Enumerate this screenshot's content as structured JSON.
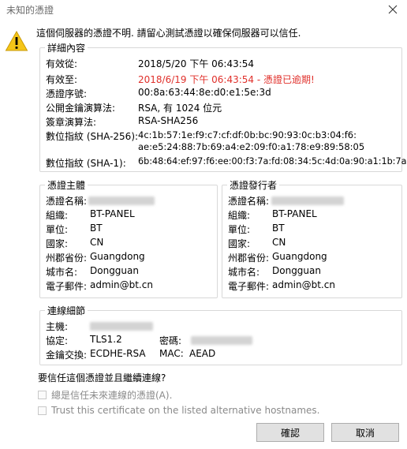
{
  "window": {
    "title": "未知的憑證"
  },
  "header": {
    "message": "這個伺服器的憑證不明. 請留心測試憑證以確保伺服器可以信任."
  },
  "details": {
    "legend": "詳細內容",
    "rows": [
      {
        "label": "有效從:",
        "value": "2018/5/20 下午 06:43:54"
      },
      {
        "label": "有效至:",
        "value": "2018/6/19 下午 06:43:54 - 憑證已逾期!"
      },
      {
        "label": "憑證序號:",
        "value": "00:8a:63:44:8e:d0:e1:5e:3d"
      },
      {
        "label": "公開金鑰演算法:",
        "value": "RSA, 有 1024 位元"
      },
      {
        "label": "簽章演算法:",
        "value": "RSA-SHA256"
      },
      {
        "label": "數位指紋 (SHA-256):",
        "value": "4c:1b:57:1e:f9:c7:cf:df:0b:bc:90:93:0c:b3:04:f6:",
        "value2": "ae:e5:24:88:7b:69:a4:e2:09:f0:a1:78:e9:89:58:05"
      },
      {
        "label": "數位指紋 (SHA-1):",
        "value": "6b:48:64:ef:97:f6:ee:00:f3:7a:fd:08:34:5c:4d:0a:90:a1:1b:7a"
      }
    ],
    "expired_color": "#e0302b"
  },
  "subject": {
    "legend": "憑證主體",
    "rows": [
      {
        "label": "憑證名稱:",
        "value": ""
      },
      {
        "label": "組織:",
        "value": "BT-PANEL"
      },
      {
        "label": "單位:",
        "value": "BT"
      },
      {
        "label": "國家:",
        "value": "CN"
      },
      {
        "label": "州郡省份:",
        "value": "Guangdong"
      },
      {
        "label": "城市名:",
        "value": "Dongguan"
      },
      {
        "label": "電子郵件:",
        "value": "admin@bt.cn"
      }
    ]
  },
  "issuer": {
    "legend": "憑證發行者",
    "rows": [
      {
        "label": "憑證名稱:",
        "value": ""
      },
      {
        "label": "組織:",
        "value": "BT-PANEL"
      },
      {
        "label": "單位:",
        "value": "BT"
      },
      {
        "label": "國家:",
        "value": "CN"
      },
      {
        "label": "州郡省份:",
        "value": "Guangdong"
      },
      {
        "label": "城市名:",
        "value": "Dongguan"
      },
      {
        "label": "電子郵件:",
        "value": "admin@bt.cn"
      }
    ]
  },
  "connection": {
    "legend": "連線細節",
    "host_label": "主機:",
    "protocol_label": "協定:",
    "protocol_value": "TLS1.2",
    "cipher_label": "密碼:",
    "kex_label": "金鑰交換:",
    "kex_value": "ECDHE-RSA",
    "mac_label": "MAC:",
    "mac_value": "AEAD"
  },
  "trust": {
    "question": "要信任這個憑證並且繼續連線?",
    "always_label": "總是信任未來連線的憑證(A).",
    "alt_label": "Trust this certificate on the listed alternative hostnames."
  },
  "buttons": {
    "ok": "確認",
    "cancel": "取消"
  },
  "icons": {
    "warning": "warning-icon",
    "close": "close-icon"
  }
}
